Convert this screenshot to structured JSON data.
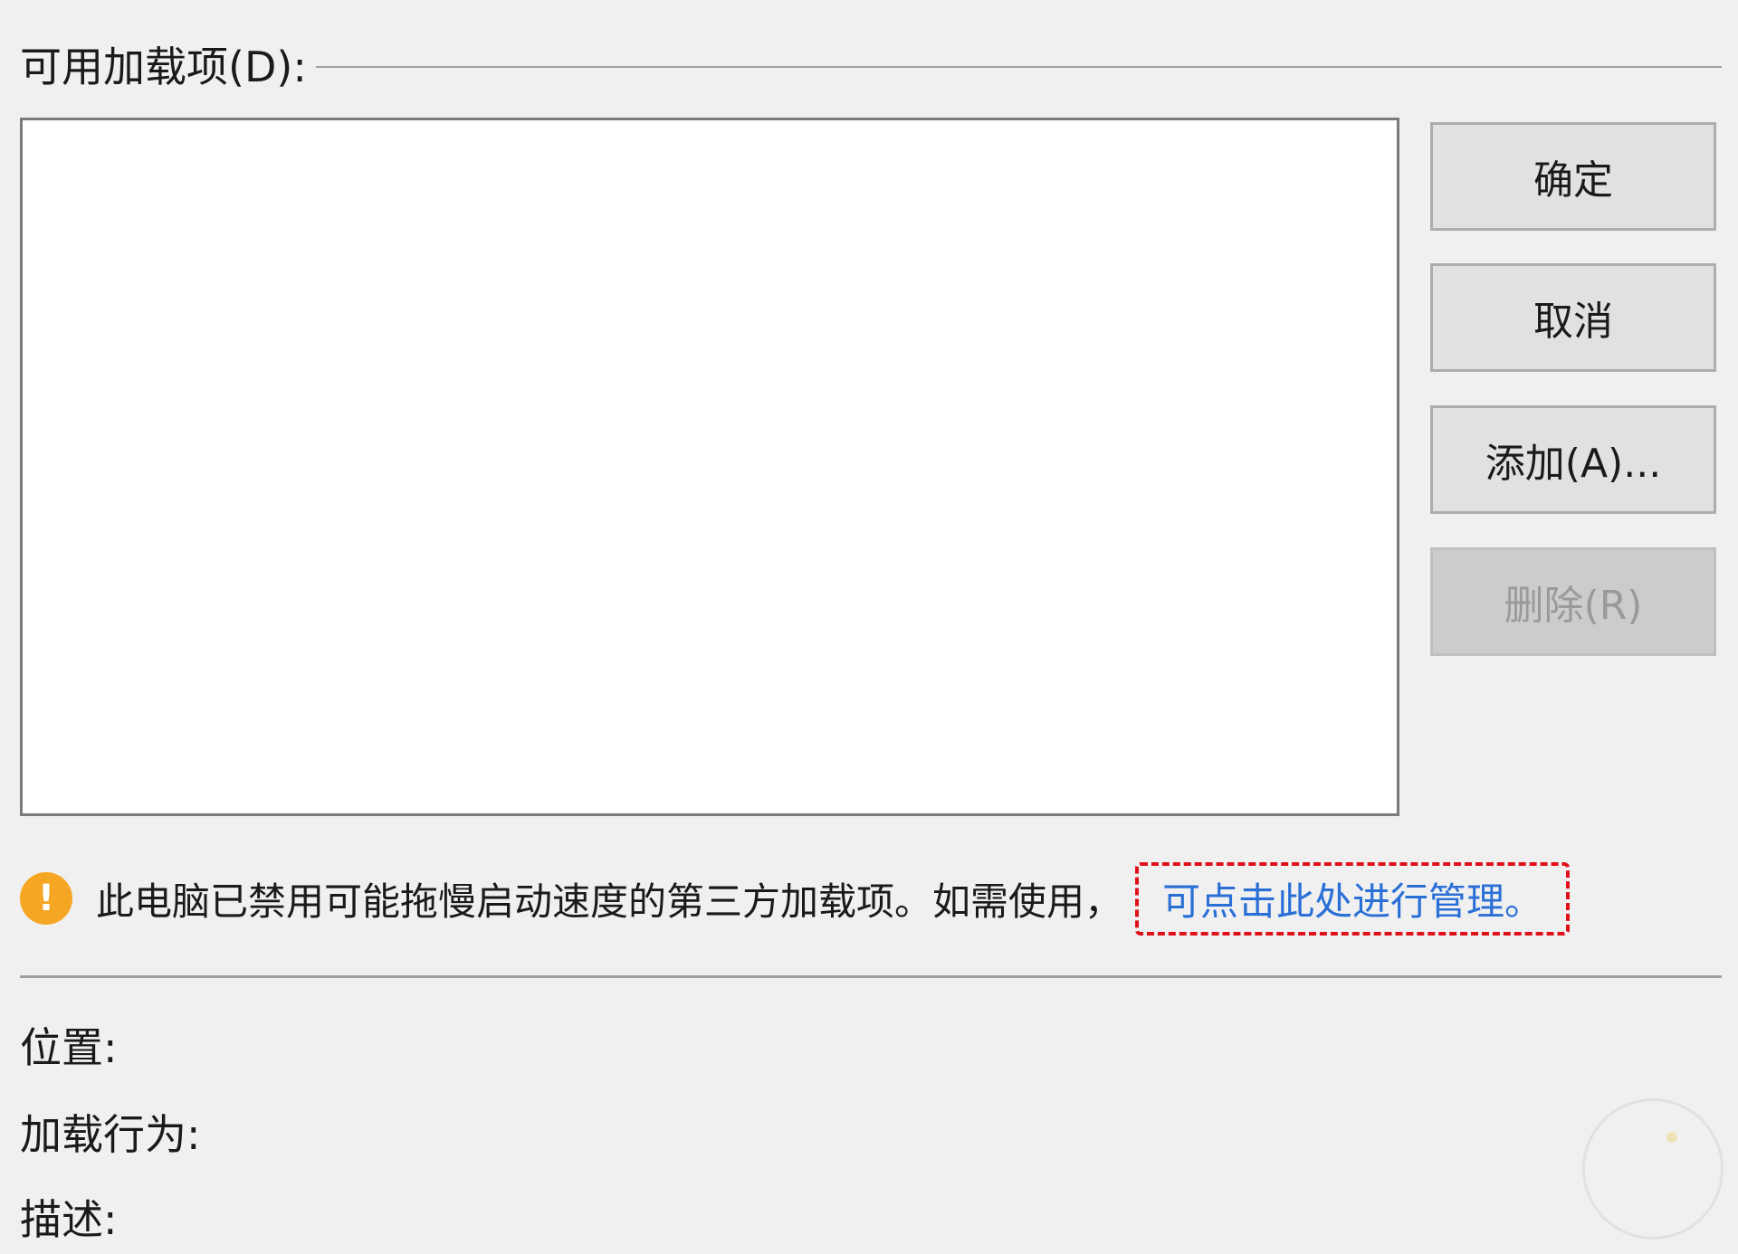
{
  "group": {
    "label": "可用加载项(D):"
  },
  "addins": [],
  "buttons": {
    "ok": "确定",
    "cancel": "取消",
    "add": "添加(A)...",
    "remove": "删除(R)"
  },
  "notice": {
    "icon": "warning-icon",
    "icon_glyph": "!",
    "icon_color": "#f5a623",
    "text": "此电脑已禁用可能拖慢启动速度的第三方加载项。如需使用，",
    "link": "可点击此处进行管理。",
    "link_color": "#2a6fd6",
    "highlight_color": "#e0101a"
  },
  "details": {
    "location_label": "位置:",
    "behavior_label": "加载行为:",
    "description_label": "描述:"
  }
}
